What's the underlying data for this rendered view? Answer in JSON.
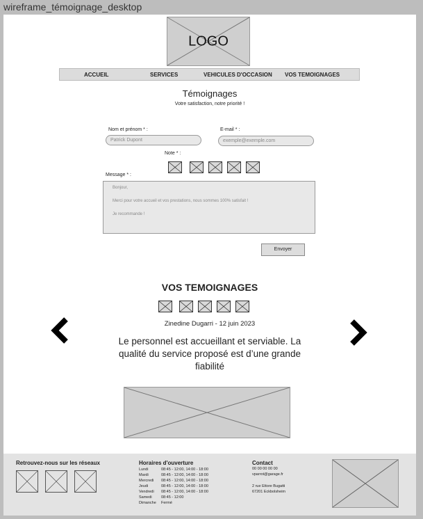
{
  "window_title": "wireframe_témoignage_desktop",
  "logo": {
    "text": "LOGO"
  },
  "nav": {
    "items": [
      "ACCUEIL",
      "SERVICES",
      "VEHICULES D'OCCASION",
      "VOS TEMOIGNAGES"
    ]
  },
  "form": {
    "title": "Témoignages",
    "subtitle": "Votre satisfaction, notre priorité !",
    "name_label": "Nom et prénom * :",
    "name_placeholder": "Patrick Dupont",
    "email_label": "E-mail * :",
    "email_placeholder": "exemple@exemple.com",
    "rating_label": "Note * :",
    "message_label": "Message * :",
    "message_lines": [
      "Bonjour,",
      "Merci pour votre accueil et vos prestations, nous sommes 100% satisfait !",
      "Je recommande !"
    ],
    "submit_label": "Envoyer"
  },
  "testimonials": {
    "title": "VOS TEMOIGNAGES",
    "author_date": "Zinedine Dugarri - 12 juin 2023",
    "quote": "Le personnel est accueillant et serviable. La qualité du service proposé est d’une grande fiabilité",
    "prev_icon": "chevron-left-icon",
    "next_icon": "chevron-right-icon"
  },
  "footer": {
    "social_title": "Retrouvez-nous sur les réseaux",
    "hours_title": "Horaires d'ouverture",
    "hours": [
      {
        "day": "Lundi",
        "time": "08:45 - 12:00, 14:00 - 18:00"
      },
      {
        "day": "Mardi",
        "time": "08:45 - 12:00, 14:00 - 18:00"
      },
      {
        "day": "Mercredi",
        "time": "08:45 - 12:00, 14:00 - 18:00"
      },
      {
        "day": "Jeudi",
        "time": "08:45 - 12:00, 14:00 - 18:00"
      },
      {
        "day": "Vendredi",
        "time": "08:45 - 12:00, 14:00 - 18:00"
      },
      {
        "day": "Samedi",
        "time": "08:45 - 12:00"
      },
      {
        "day": "Dimanche",
        "time": "Fermé"
      }
    ],
    "contact_title": "Contact",
    "phone": "00 00 00 00 00",
    "email": "vparrot@garage.fr",
    "address1": "2 rue Ettore Bugatti",
    "address2": "67201 Eckbolsheim"
  }
}
